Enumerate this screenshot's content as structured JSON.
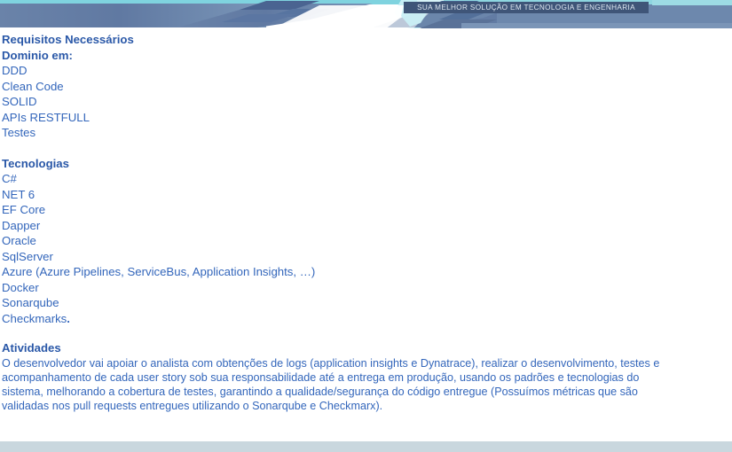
{
  "header": {
    "tagline": "SUA MELHOR SOLUÇÃO EM TECNOLOGIA E ENGENHARIA",
    "colors": {
      "top_strip": "#7fd3df",
      "band": "#657fa6",
      "band_dark": "#4a6491",
      "accent_cyan": "#c5eef5",
      "tagline_bg": "#3f5578",
      "tagline_text": "#dfe8f2"
    }
  },
  "sections": {
    "requirements": {
      "title": "Requisitos Necessários",
      "subtitle": "Dominio em",
      "subtitle_suffix": ":",
      "items": [
        "DDD",
        "Clean Code",
        "SOLID",
        "APIs RESTFULL",
        "Testes"
      ]
    },
    "technologies": {
      "title": "Tecnologias",
      "items": [
        "C#",
        "NET 6",
        "EF Core",
        "Dapper",
        "Oracle",
        "SqlServer",
        "Azure (Azure Pipelines, ServiceBus, Application Insights, …)",
        "Docker",
        "Sonarqube",
        "Checkmarks"
      ],
      "last_item_period": "."
    },
    "activities": {
      "title": "Atividades",
      "paragraph_lines": [
        "O desenvolvedor vai apoiar o analista com obtenções de logs (application insights e Dynatrace), realizar o desenvolvimento, testes e",
        "acompanhamento de cada user story sob sua responsabilidade até a entrega em produção, usando os padrões e tecnologias do",
        "sistema, melhorando a cobertura de testes, garantindo a qualidade/segurança do código entregue (Possuímos métricas que são",
        "validadas nos pull requests entregues utilizando o Sonarqube e Checkmarx)."
      ]
    }
  },
  "footer": {
    "bar_color": "#c9d7de"
  },
  "theme": {
    "heading_color": "#2a58a8",
    "body_color": "#3366bb",
    "page_background": "#ffffff"
  }
}
